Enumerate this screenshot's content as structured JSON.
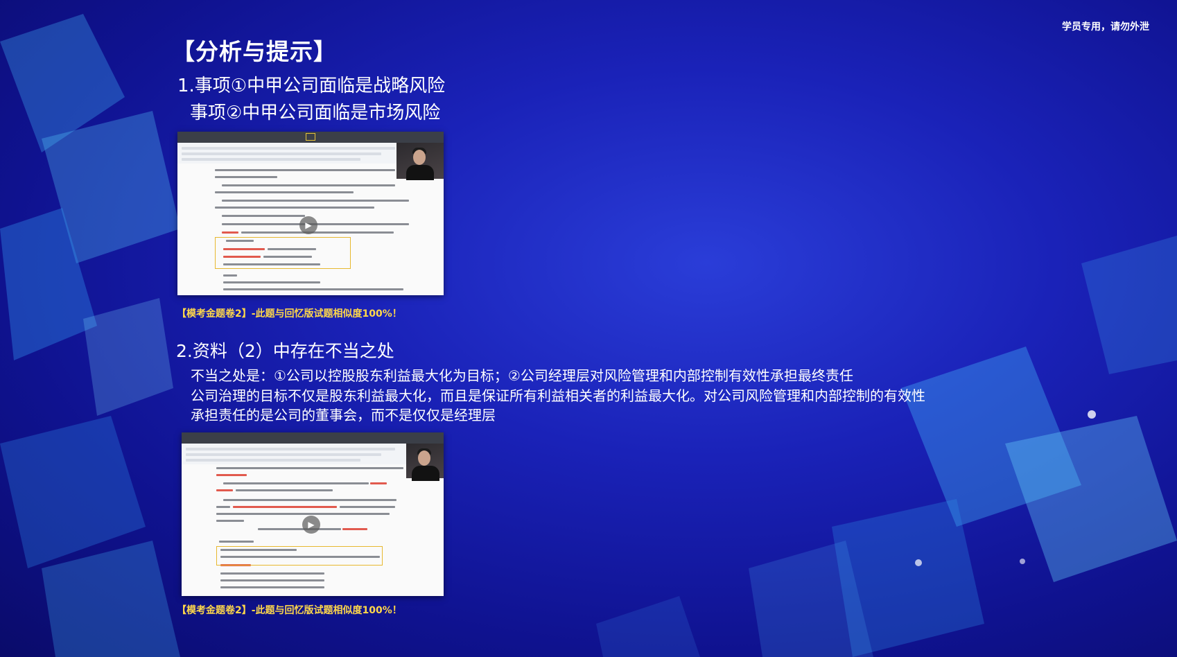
{
  "watermark": "学员专用，请勿外泄",
  "heading": "【分析与提示】",
  "section1": {
    "line1": "1.事项①中甲公司面临是战略风险",
    "line2": "事项②中甲公司面临是市场风险"
  },
  "caption1": "【模考金题卷2】-此题与回忆版试题相似度100%！",
  "section2": {
    "heading": "2.资料（2）中存在不当之处",
    "body1": "不当之处是：①公司以控股股东利益最大化为目标；②公司经理层对风险管理和内部控制有效性承担最终责任",
    "body2": "公司治理的目标不仅是股东利益最大化，而且是保证所有利益相关者的利益最大化。对公司风险管理和内部控制的有效性",
    "body3": "承担责任的是公司的董事会，而不是仅仅是经理层"
  },
  "caption2": "【模考金题卷2】-此题与回忆版试题相似度100%！",
  "colors": {
    "caption": "#ffd84a",
    "highlight_box": "#e7b82f",
    "background": "#1a22b8"
  },
  "icons": {
    "play": "play-icon"
  }
}
